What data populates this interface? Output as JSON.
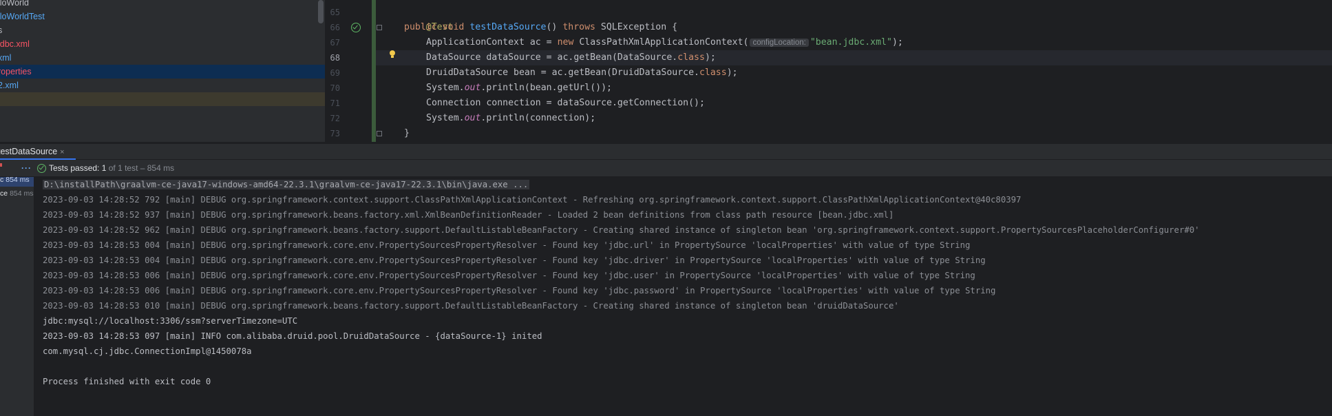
{
  "project_tree": {
    "rows": [
      {
        "label": "lloWorld",
        "color": "#bcbec4",
        "bg": ""
      },
      {
        "label": "lloWorldTest",
        "color": "#56a8f5",
        "bg": ""
      },
      {
        "label": "s",
        "color": "#bcbec4",
        "bg": ""
      },
      {
        "label": "jdbc.xml",
        "color": "#f75464",
        "bg": ""
      },
      {
        "label": "xml",
        "color": "#56a8f5",
        "bg": ""
      },
      {
        "label": "roperties",
        "color": "#f75464",
        "bg": "#0d2d52"
      },
      {
        "label": "2.xml",
        "color": "#56a8f5",
        "bg": ""
      },
      {
        "label": "",
        "color": "#bcbec4",
        "bg": "#3d3a2e"
      }
    ]
  },
  "editor": {
    "current_line": "68",
    "line_numbers": [
      "65",
      "66",
      "67",
      "68",
      "69",
      "70",
      "71",
      "72",
      "73"
    ],
    "code": {
      "l65": {
        "annotation": "@Test"
      },
      "l66": {
        "kw_public": "public",
        "kw_void": "void",
        "method": "testDataSource",
        "parens": "()",
        "kw_throws": "throws",
        "exception": "SQLException",
        "brace": "{"
      },
      "l67": {
        "type": "ApplicationContext ac = ",
        "kw_new": "new",
        "ctor": " ClassPathXmlApplicationContext(",
        "hint": "configLocation:",
        "str": "\"bean.jdbc.xml\"",
        "end": ");"
      },
      "l68": {
        "pre": "DataSource dataSource = ac.getBean(DataSource.",
        "kw_class": "class",
        "end": ");"
      },
      "l69": {
        "pre": "DruidDataSource bean = ac.getBean(DruidDataSource.",
        "kw_class": "class",
        "end": ");"
      },
      "l70": {
        "pre": "System.",
        "out": "out",
        "mid": ".println(bean.getUrl());"
      },
      "l71": {
        "pre": "Connection connection = dataSource.getConnection();"
      },
      "l72": {
        "pre": "System.",
        "out": "out",
        "mid": ".println(connection);"
      },
      "l73": {
        "brace": "}"
      }
    }
  },
  "run_tab": {
    "label": "testDataSource",
    "close": "×"
  },
  "status": {
    "dots": "···",
    "passed": "Tests passed: 1",
    "sub": " of 1 test – 854 ms"
  },
  "test_tree": {
    "rows": [
      {
        "label": "",
        "duration": ""
      },
      {
        "label": "c",
        "duration": "854 ms",
        "selected": true
      },
      {
        "label": "ce",
        "duration": "854 ms",
        "selected": false
      }
    ]
  },
  "console": {
    "lines": [
      {
        "text": "D:\\installPath\\graalvm-ce-java17-windows-amd64-22.3.1\\graalvm-ce-java17-22.3.1\\bin\\java.exe ...",
        "style": "cmd"
      },
      {
        "text": "2023-09-03 14:28:52 792 [main] DEBUG org.springframework.context.support.ClassPathXmlApplicationContext - Refreshing org.springframework.context.support.ClassPathXmlApplicationContext@40c80397",
        "style": "dim"
      },
      {
        "text": "2023-09-03 14:28:52 937 [main] DEBUG org.springframework.beans.factory.xml.XmlBeanDefinitionReader - Loaded 2 bean definitions from class path resource [bean.jdbc.xml]",
        "style": "dim"
      },
      {
        "text": "2023-09-03 14:28:52 962 [main] DEBUG org.springframework.beans.factory.support.DefaultListableBeanFactory - Creating shared instance of singleton bean 'org.springframework.context.support.PropertySourcesPlaceholderConfigurer#0'",
        "style": "dim"
      },
      {
        "text": "2023-09-03 14:28:53 004 [main] DEBUG org.springframework.core.env.PropertySourcesPropertyResolver - Found key 'jdbc.url' in PropertySource 'localProperties' with value of type String",
        "style": "dim"
      },
      {
        "text": "2023-09-03 14:28:53 004 [main] DEBUG org.springframework.core.env.PropertySourcesPropertyResolver - Found key 'jdbc.driver' in PropertySource 'localProperties' with value of type String",
        "style": "dim"
      },
      {
        "text": "2023-09-03 14:28:53 006 [main] DEBUG org.springframework.core.env.PropertySourcesPropertyResolver - Found key 'jdbc.user' in PropertySource 'localProperties' with value of type String",
        "style": "dim"
      },
      {
        "text": "2023-09-03 14:28:53 006 [main] DEBUG org.springframework.core.env.PropertySourcesPropertyResolver - Found key 'jdbc.password' in PropertySource 'localProperties' with value of type String",
        "style": "dim"
      },
      {
        "text": "2023-09-03 14:28:53 010 [main] DEBUG org.springframework.beans.factory.support.DefaultListableBeanFactory - Creating shared instance of singleton bean 'druidDataSource'",
        "style": "dim"
      },
      {
        "text": "jdbc:mysql://localhost:3306/ssm?serverTimezone=UTC",
        "style": "norm"
      },
      {
        "text": "2023-09-03 14:28:53 097 [main] INFO com.alibaba.druid.pool.DruidDataSource - {dataSource-1} inited",
        "style": "norm"
      },
      {
        "text": "com.mysql.cj.jdbc.ConnectionImpl@1450078a",
        "style": "norm"
      },
      {
        "text": "",
        "style": "norm"
      },
      {
        "text": "Process finished with exit code 0",
        "style": "norm"
      }
    ]
  }
}
